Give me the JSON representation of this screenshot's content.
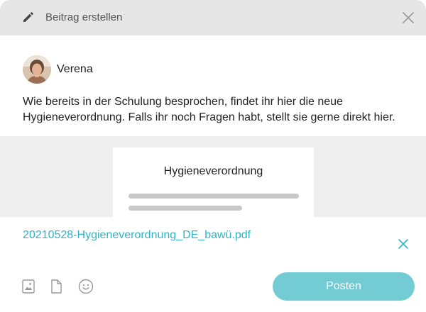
{
  "header": {
    "title": "Beitrag erstellen",
    "edit_icon": "pencil-icon",
    "close_icon": "close-icon"
  },
  "post": {
    "author_name": "Verena",
    "text": "Wie bereits in der Schulung besprochen, findet ihr hier die neue Hygieneverordnung. Falls ihr noch Fragen habt, stellt sie gerne direkt hier."
  },
  "preview": {
    "document_title": "Hygieneverordnung"
  },
  "attachment": {
    "file_name": "20210528-Hygieneverordnung_DE_bawü.pdf",
    "remove_icon": "close-icon"
  },
  "toolbar": {
    "icons": [
      "image-icon",
      "file-icon",
      "emoji-icon"
    ],
    "post_label": "Posten"
  },
  "colors": {
    "accent": "#2eb4c8",
    "post_button": "#73cbd3",
    "header_bg": "#e6e6e6",
    "preview_bg": "#eeeeee"
  }
}
